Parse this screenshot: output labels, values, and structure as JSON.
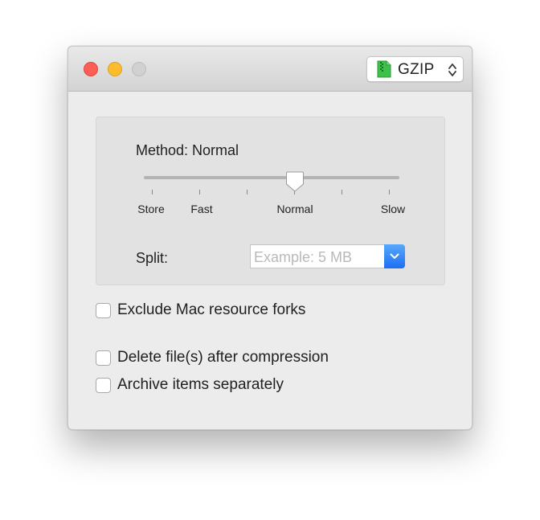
{
  "titlebar": {
    "format_popup": {
      "selected": "GZIP",
      "icon": "zip-file-icon",
      "icon_color": "#3cc24a"
    },
    "traffic_lights": {
      "close_color": "#fd5f57",
      "minimize_color": "#fdbc2e",
      "zoom_color": "#d1d1d1"
    }
  },
  "compression": {
    "method_label": "Method: Normal",
    "slider": {
      "tick_labels": [
        "Store",
        "Fast",
        "Normal",
        "Slow"
      ],
      "tick_count": 6,
      "selected": "Normal"
    },
    "split": {
      "label": "Split:",
      "value": "",
      "placeholder": "Example: 5 MB",
      "dropdown_color": "#2b7ff6"
    }
  },
  "options": {
    "exclude_resource_forks": {
      "label": "Exclude Mac resource forks",
      "checked": false
    },
    "delete_after_compression": {
      "label": "Delete file(s) after compression",
      "checked": false
    },
    "archive_separately": {
      "label": "Archive items separately",
      "checked": false
    }
  }
}
